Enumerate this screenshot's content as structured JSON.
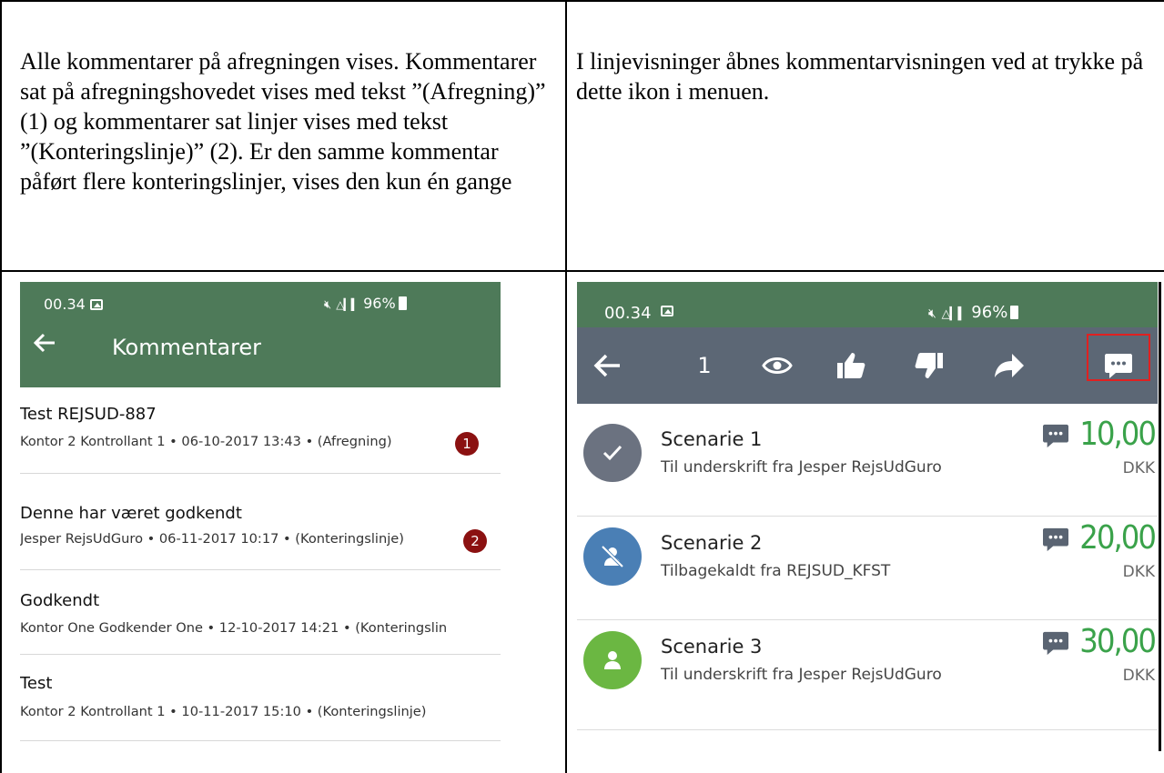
{
  "doc": {
    "left_text": "Alle kommentarer på afregningen vises. Kommentarer sat på afregningshovedet vises med tekst ”(Afregning)” (1) og kommentarer sat linjer vises med tekst ”(Konteringslinje)” (2). Er den samme kommentar påført flere konteringslinjer, vises den kun én gange",
    "right_text": "I linjevisninger åbnes kommentarvisningen ved at trykke på dette ikon i menuen."
  },
  "left_screen": {
    "status": {
      "time": "00.34",
      "right": "96%"
    },
    "header_title": "Kommentarer",
    "comments": [
      {
        "title": "Test REJSUD-887",
        "subtitle": "Kontor 2 Kontrollant 1 • 06-10-2017 13:43 • (Afregning)",
        "badge": "1"
      },
      {
        "title": "Denne har været godkendt",
        "subtitle": "Jesper RejsUdGuro • 06-11-2017 10:17 • (Konteringslinje)",
        "badge": "2"
      },
      {
        "title": "Godkendt",
        "subtitle": "Kontor One Godkender One • 12-10-2017 14:21 • (Konteringslin",
        "badge": ""
      },
      {
        "title": "Test",
        "subtitle": "Kontor 2 Kontrollant 1 • 10-11-2017 15:10 • (Konteringslinje)",
        "badge": ""
      }
    ]
  },
  "right_screen": {
    "status": {
      "time": "00.34",
      "right": "96%"
    },
    "toolbar": {
      "count": "1"
    },
    "items": [
      {
        "title": "Scenarie 1",
        "subtitle": "Til underskrift fra Jesper RejsUdGuro",
        "amount": "10,00",
        "currency": "DKK",
        "avatar_color": "#6b7280",
        "icon": "check-icon"
      },
      {
        "title": "Scenarie 2",
        "subtitle": "Tilbagekaldt fra REJSUD_KFST",
        "amount": "20,00",
        "currency": "DKK",
        "avatar_color": "#4a7fb5",
        "icon": "person-crossed-icon"
      },
      {
        "title": "Scenarie 3",
        "subtitle": "Til underskrift fra Jesper RejsUdGuro",
        "amount": "30,00",
        "currency": "DKK",
        "avatar_color": "#6bb742",
        "icon": "person-icon"
      }
    ],
    "colors": {
      "amount": "#3aa24a",
      "toolbar": "#5c6775",
      "statusbar": "#4e7a59",
      "highlight": "#e02020"
    }
  }
}
